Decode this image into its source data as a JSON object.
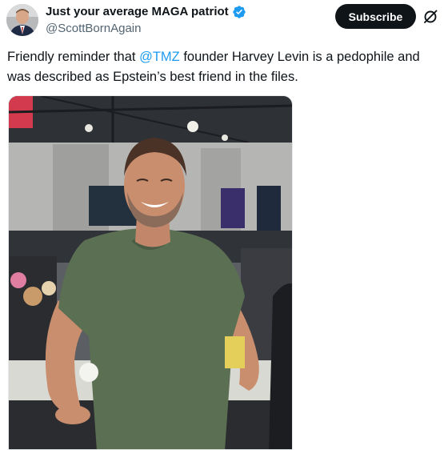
{
  "author": {
    "display_name": "Just your average MAGA patriot",
    "handle": "@ScottBornAgain",
    "verified": true,
    "verified_badge_color": "#1d9bf0"
  },
  "actions": {
    "subscribe_label": "Subscribe",
    "grok_icon": "grok-icon"
  },
  "tweet": {
    "text_before": "Friendly reminder that ",
    "mention": "@TMZ",
    "text_after": " founder Harvey Levin is a pedophile and was described as Epstein’s best friend in the files."
  },
  "colors": {
    "accent": "#1d9bf0",
    "text_primary": "#0f1419",
    "text_secondary": "#536471",
    "button_bg": "#0f1419"
  }
}
